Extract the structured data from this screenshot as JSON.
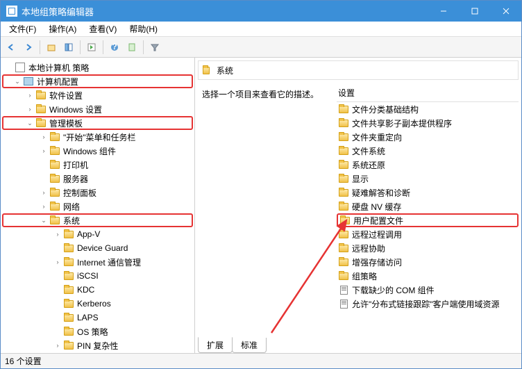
{
  "window": {
    "title": "本地组策略编辑器"
  },
  "menu": {
    "file": "文件(F)",
    "action": "操作(A)",
    "view": "查看(V)",
    "help": "帮助(H)"
  },
  "tree": {
    "root": "本地计算机 策略",
    "computer_config": "计算机配置",
    "software_settings": "软件设置",
    "windows_settings": "Windows 设置",
    "admin_templates": "管理模板",
    "start_menu": "\"开始\"菜单和任务栏",
    "windows_components": "Windows 组件",
    "printers": "打印机",
    "servers": "服务器",
    "control_panel": "控制面板",
    "network": "网络",
    "system": "系统",
    "sys_children": {
      "app_v": "App-V",
      "device_guard": "Device Guard",
      "internet_comm": "Internet 通信管理",
      "iscsi": "iSCSI",
      "kdc": "KDC",
      "kerberos": "Kerberos",
      "laps": "LAPS",
      "os_policy": "OS 策略",
      "pin": "PIN 复杂性"
    }
  },
  "right": {
    "header": "系统",
    "description": "选择一个项目来查看它的描述。",
    "col_header": "设置",
    "items": [
      {
        "type": "folder",
        "label": "文件分类基础结构"
      },
      {
        "type": "folder",
        "label": "文件共享影子副本提供程序"
      },
      {
        "type": "folder",
        "label": "文件夹重定向"
      },
      {
        "type": "folder",
        "label": "文件系统"
      },
      {
        "type": "folder",
        "label": "系统还原"
      },
      {
        "type": "folder",
        "label": "显示"
      },
      {
        "type": "folder",
        "label": "疑难解答和诊断"
      },
      {
        "type": "folder",
        "label": "硬盘 NV 缓存"
      },
      {
        "type": "folder",
        "label": "用户配置文件",
        "hl": true
      },
      {
        "type": "folder",
        "label": "远程过程调用"
      },
      {
        "type": "folder",
        "label": "远程协助"
      },
      {
        "type": "folder",
        "label": "增强存储访问"
      },
      {
        "type": "folder",
        "label": "组策略"
      },
      {
        "type": "doc",
        "label": "下载缺少的 COM 组件"
      },
      {
        "type": "doc",
        "label": "允许\"分布式链接跟踪\"客户端使用域资源"
      }
    ],
    "tabs": {
      "extended": "扩展",
      "standard": "标准"
    }
  },
  "status": {
    "text": "16 个设置"
  }
}
